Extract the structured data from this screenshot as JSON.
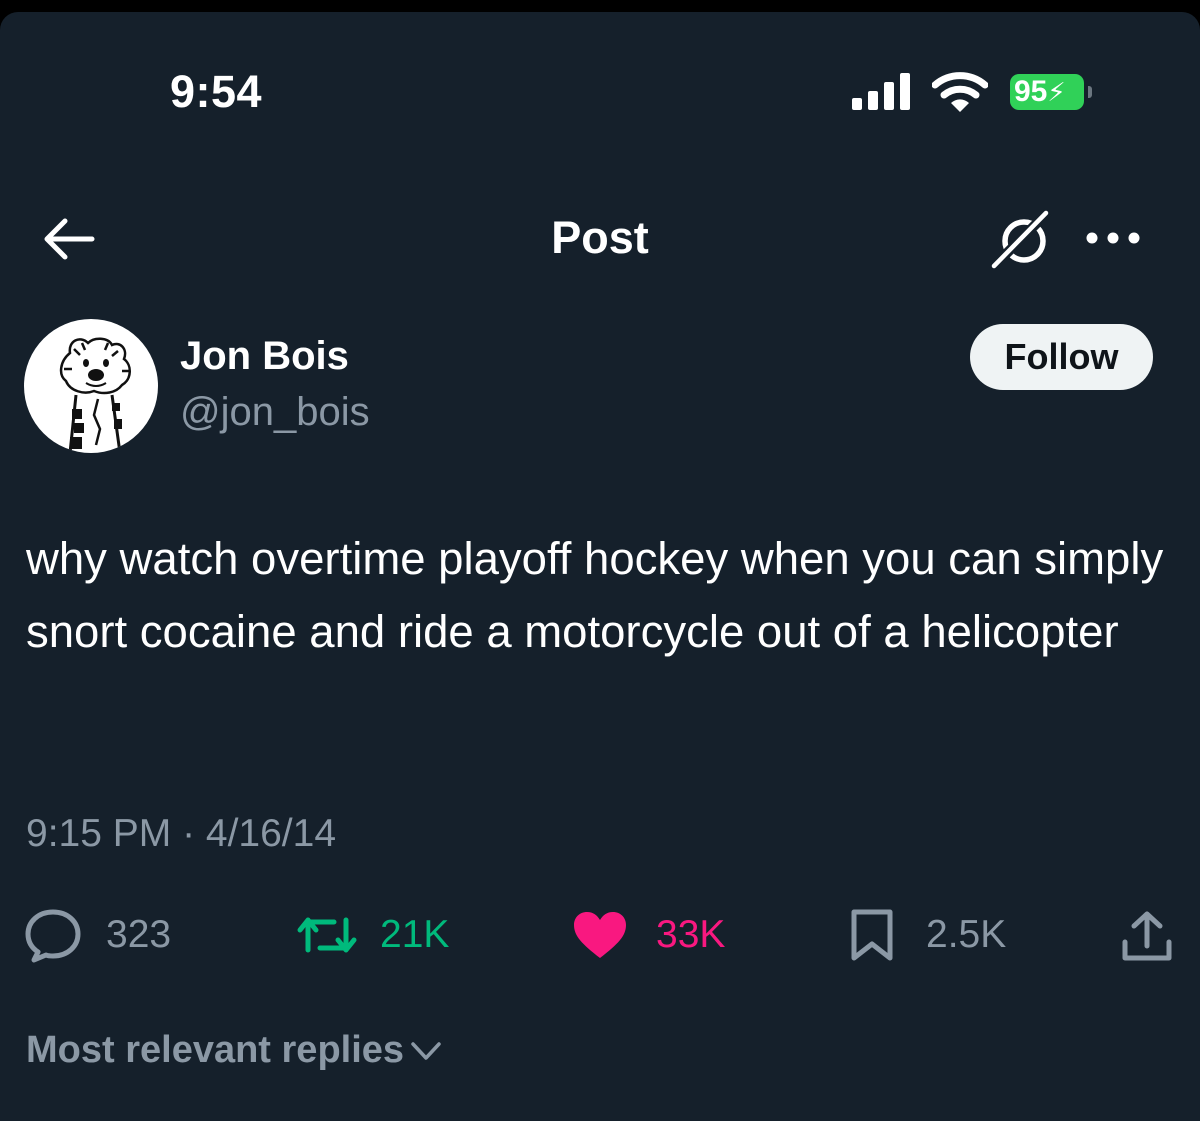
{
  "status_bar": {
    "time": "9:54",
    "battery_percent": "95",
    "battery_color": "#30d158"
  },
  "header": {
    "title": "Post",
    "back_icon": "arrow-left-icon",
    "grok_icon": "grok-icon",
    "more_icon": "more-horizontal-icon"
  },
  "author": {
    "name": "Jon Bois",
    "handle": "@jon_bois",
    "follow_label": "Follow"
  },
  "post": {
    "text": "why watch overtime playoff hockey when you can simply snort cocaine and ride a motorcycle out of a helicopter",
    "timestamp": "9:15 PM · 4/16/14"
  },
  "actions": {
    "replies": "323",
    "retweets": "21K",
    "likes": "33K",
    "bookmarks": "2.5K",
    "retweet_color": "#00ba7c",
    "like_color": "#f91880"
  },
  "replies_sort": {
    "label": "Most relevant replies"
  }
}
